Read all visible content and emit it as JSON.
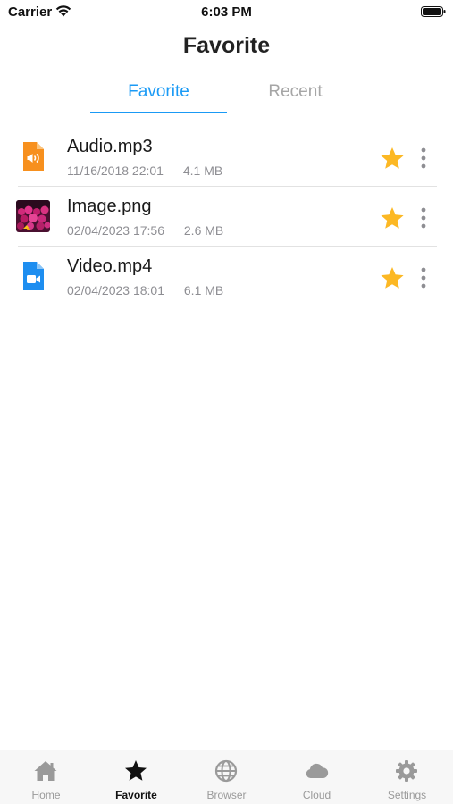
{
  "status_bar": {
    "carrier": "Carrier",
    "time": "6:03 PM"
  },
  "header": {
    "title": "Favorite"
  },
  "tabs": [
    {
      "label": "Favorite",
      "active": true
    },
    {
      "label": "Recent",
      "active": false
    }
  ],
  "files": [
    {
      "name": "Audio.mp3",
      "date": "11/16/2018 22:01",
      "size": "4.1 MB",
      "icon": "audio-file-icon",
      "favorite": true
    },
    {
      "name": "Image.png",
      "date": "02/04/2023 17:56",
      "size": "2.6 MB",
      "icon": "image-thumbnail",
      "favorite": true
    },
    {
      "name": "Video.mp4",
      "date": "02/04/2023 18:01",
      "size": "6.1 MB",
      "icon": "video-file-icon",
      "favorite": true
    }
  ],
  "tab_bar": {
    "items": [
      {
        "label": "Home",
        "icon": "home-icon",
        "active": false
      },
      {
        "label": "Favorite",
        "icon": "star-icon",
        "active": true
      },
      {
        "label": "Browser",
        "icon": "globe-icon",
        "active": false
      },
      {
        "label": "Cloud",
        "icon": "cloud-icon",
        "active": false
      },
      {
        "label": "Settings",
        "icon": "gear-icon",
        "active": false
      }
    ]
  },
  "colors": {
    "accent": "#1a9af5",
    "star": "#fcb824",
    "audio_icon": "#f7901e",
    "video_icon": "#1e8ef0"
  }
}
